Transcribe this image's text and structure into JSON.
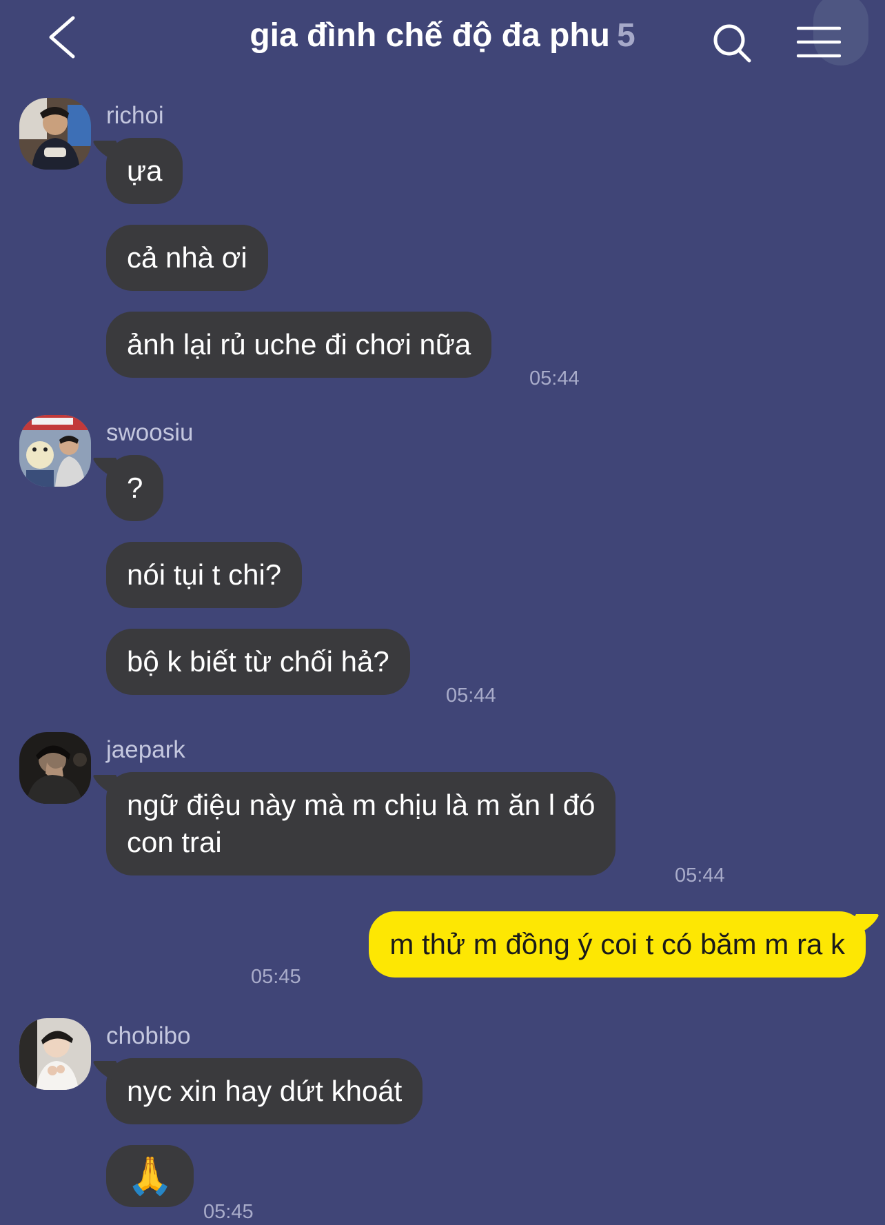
{
  "header": {
    "title": "gia đình chế độ đa phu",
    "member_count": "5"
  },
  "messages": {
    "m0": {
      "sender": "richoi",
      "lines": [
        "ựa",
        "cả nhà ơi",
        "ảnh lại rủ uche đi chơi nữa"
      ],
      "time": "05:44"
    },
    "m1": {
      "sender": "swoosiu",
      "lines": [
        "?",
        "nói tụi t chi?",
        "bộ k biết từ chối hả?"
      ],
      "time": "05:44"
    },
    "m2": {
      "sender": "jaepark",
      "line1": "ngữ điệu này mà m chịu là m ăn l đó",
      "line2": "con trai",
      "time": "05:44"
    },
    "mine": {
      "text": "m thử m đồng ý coi t có băm m ra k",
      "time": "05:45"
    },
    "m3": {
      "sender": "chobibo",
      "lines": [
        "nyc xin hay dứt khoát",
        "🙏"
      ],
      "time": "05:45"
    }
  },
  "colors": {
    "background": "#404577",
    "bubble_other": "#3a3a3d",
    "bubble_mine": "#fde703",
    "timestamp": "#a9acca",
    "sender_name": "#c4c7de"
  },
  "icons": {
    "back": "chevron-left-icon",
    "search": "search-icon",
    "menu": "hamburger-menu-icon"
  }
}
